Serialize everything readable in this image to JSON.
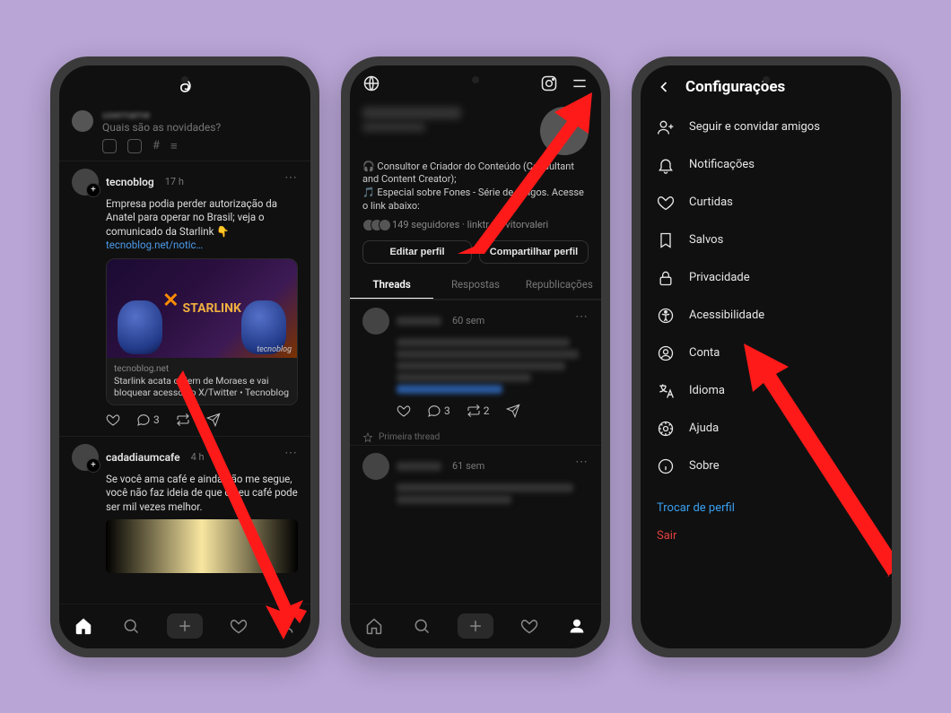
{
  "phone1": {
    "compose_placeholder": "Quais são as novidades?",
    "post1": {
      "user": "tecnoblog",
      "time": "17 h",
      "body": "Empresa podia perder autorização da Anatel para operar no Brasil; veja o comunicado da Starlink 👇",
      "link": "tecnoblog.net/notic…",
      "card_brand": "STARLINK",
      "card_watermark": "tecnoblog",
      "card_source": "tecnoblog.net",
      "card_title": "Starlink acata ordem de Moraes e vai bloquear acesso ao X/Twitter • Tecnoblog",
      "comment_count": "3"
    },
    "post2": {
      "user": "cadadiaumcafe",
      "time": "4 h",
      "body": "Se você ama café e ainda não me segue, você não faz ideia de que o seu café pode ser mil vezes melhor."
    }
  },
  "phone2": {
    "bio_line1": "🎧 Consultor e Criador do Conteúdo (Consultant and Content Creator);",
    "bio_line2": "🎵 Especial sobre Fones - Série de artigos. Acesse o link abaixo:",
    "followers_text": "149 seguidores · linktr.ee/vitorvaleri",
    "edit_btn": "Editar perfil",
    "share_btn": "Compartilhar perfil",
    "tabs": {
      "threads": "Threads",
      "replies": "Respostas",
      "reposts": "Republicações"
    },
    "post1_time": "60 sem",
    "post1_comments": "3",
    "post1_reposts": "2",
    "first_thread": "Primeira thread",
    "post2_time": "61 sem"
  },
  "phone3": {
    "title": "Configurações",
    "items": {
      "follow": "Seguir e convidar amigos",
      "notifications": "Notificações",
      "likes": "Curtidas",
      "saved": "Salvos",
      "privacy": "Privacidade",
      "accessibility": "Acessibilidade",
      "account": "Conta",
      "language": "Idioma",
      "help": "Ajuda",
      "about": "Sobre"
    },
    "switch_profile": "Trocar de perfil",
    "logout": "Sair"
  }
}
